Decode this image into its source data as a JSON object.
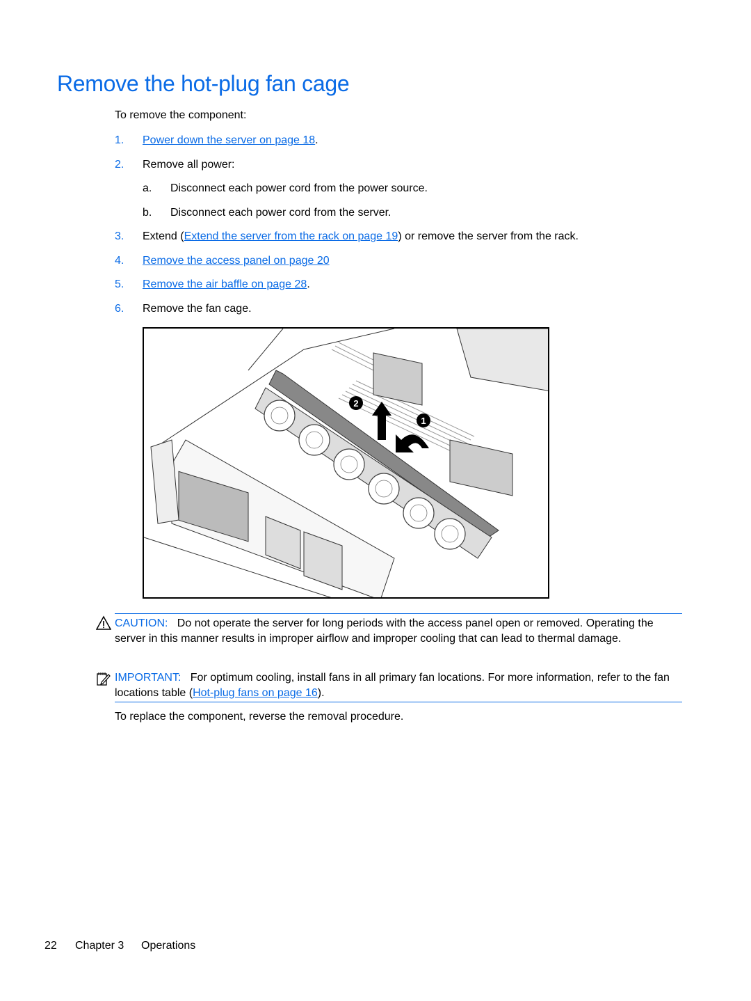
{
  "title": "Remove the hot-plug fan cage",
  "intro": "To remove the component:",
  "steps": [
    {
      "num": "1.",
      "link": "Power down the server on page 18",
      "after": "."
    },
    {
      "num": "2.",
      "text": "Remove all power:",
      "substeps": [
        {
          "letter": "a.",
          "text": "Disconnect each power cord from the power source."
        },
        {
          "letter": "b.",
          "text": "Disconnect each power cord from the server."
        }
      ]
    },
    {
      "num": "3.",
      "before": "Extend (",
      "link": "Extend the server from the rack on page 19",
      "after": ") or remove the server from the rack."
    },
    {
      "num": "4.",
      "link": "Remove the access panel on page 20"
    },
    {
      "num": "5.",
      "link": "Remove the air baffle on page 28",
      "after": "."
    },
    {
      "num": "6.",
      "text": "Remove the fan cage."
    }
  ],
  "figure": {
    "description": "Illustration of server with fan cage being removed",
    "callouts": [
      "2",
      "1"
    ]
  },
  "caution": {
    "icon": "warning-triangle-icon",
    "label": "CAUTION:",
    "text": "Do not operate the server for long periods with the access panel open or removed. Operating the server in this manner results in improper airflow and improper cooling that can lead to thermal damage."
  },
  "important": {
    "icon": "note-pencil-icon",
    "label": "IMPORTANT:",
    "before": "For optimum cooling, install fans in all primary fan locations. For more information, refer to the fan locations table (",
    "link": "Hot-plug fans on page 16",
    "after": ")."
  },
  "closing": "To replace the component, reverse the removal procedure.",
  "footer": {
    "page_number": "22",
    "chapter": "Chapter 3",
    "section": "Operations"
  },
  "colors": {
    "accent": "#0a6be6",
    "text": "#000000"
  }
}
